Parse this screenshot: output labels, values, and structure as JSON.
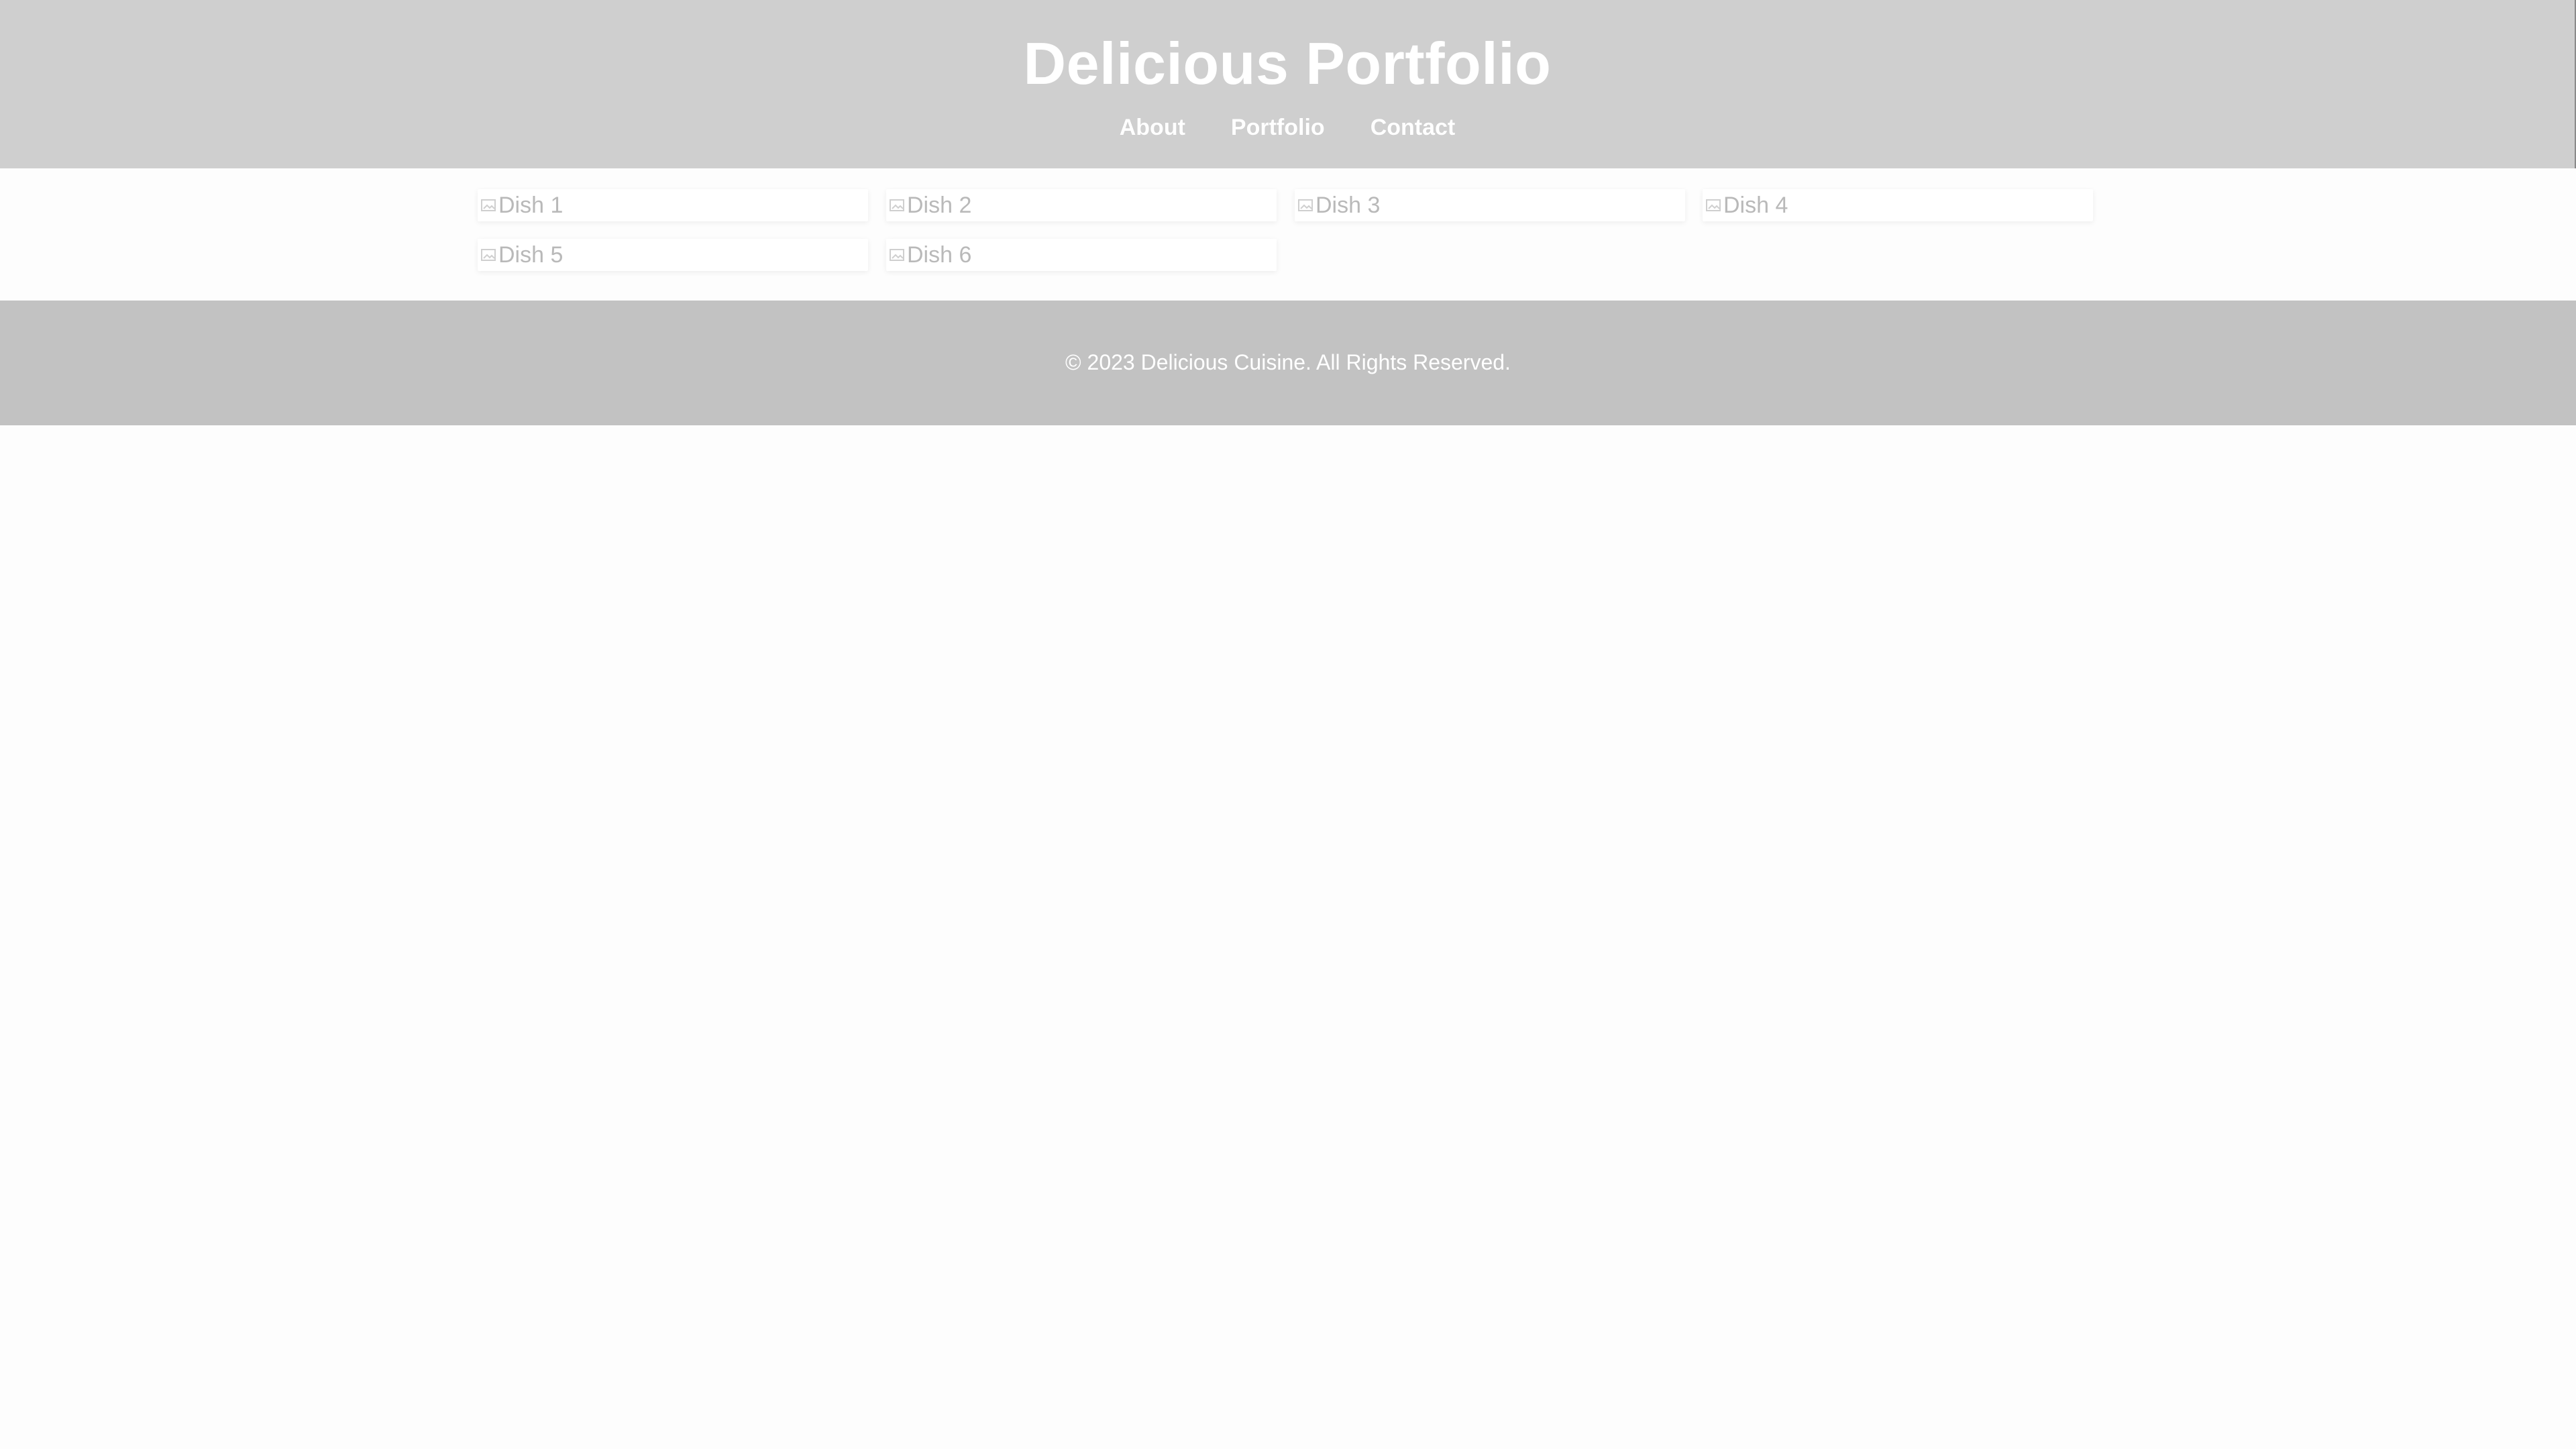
{
  "header": {
    "title": "Delicious Portfolio",
    "nav": [
      "About",
      "Portfolio",
      "Contact"
    ]
  },
  "portfolio": {
    "dishes": [
      "Dish 1",
      "Dish 2",
      "Dish 3",
      "Dish 4",
      "Dish 5",
      "Dish 6"
    ]
  },
  "footer": {
    "copyright": "© 2023 Delicious Cuisine. All Rights Reserved."
  },
  "colors": {
    "header_bg": "#cfcfcf",
    "footer_bg": "#c2c2c2",
    "page_bg": "#fdfdfd",
    "text_white": "#ffffff",
    "alt_text": "#b9b9b9"
  },
  "icons": {
    "broken_image": "broken-image-icon"
  }
}
